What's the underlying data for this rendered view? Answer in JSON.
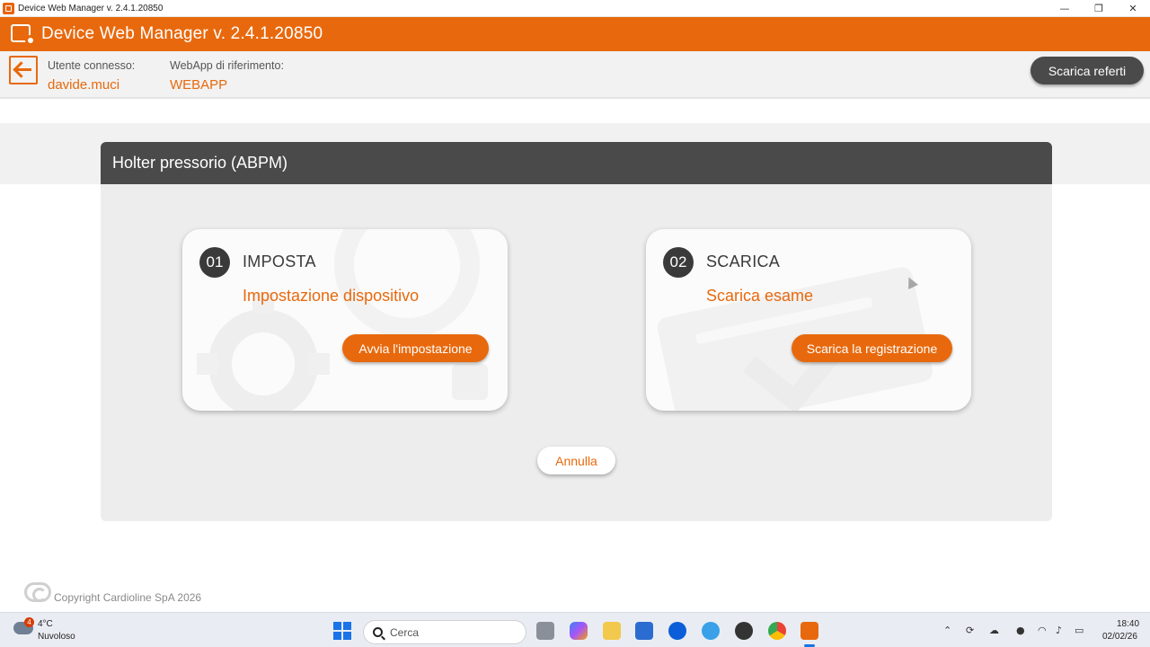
{
  "window": {
    "title": "Device Web Manager v. 2.4.1.20850",
    "controls": {
      "minimize": "—",
      "restore": "❐",
      "close": "✕"
    }
  },
  "header": {
    "app_name": "Device Web Manager v. 2.4.1.20850"
  },
  "info": {
    "user_label": "Utente connesso:",
    "user_value": "davide.muci",
    "webapp_label": "WebApp di riferimento:",
    "webapp_value": "WEBAPP",
    "download_reports_button": "Scarica referti"
  },
  "panel": {
    "title": "Holter pressorio (ABPM)",
    "cards": [
      {
        "number": "01",
        "title": "IMPOSTA",
        "subtitle": "Impostazione dispositivo",
        "button": "Avvia l'impostazione",
        "icon": "gear-icon"
      },
      {
        "number": "02",
        "title": "SCARICA",
        "subtitle": "Scarica esame",
        "button": "Scarica la registrazione",
        "icon": "download-icon"
      }
    ],
    "cancel_button": "Annulla"
  },
  "footer": {
    "copyright": "Copyright Cardioline SpA 2026"
  },
  "taskbar": {
    "weather_badge": "4",
    "temperature": "4°C",
    "weather": "Nuvoloso",
    "search_placeholder": "Cerca",
    "time": "18:40",
    "date": "02/02/26"
  },
  "colors": {
    "accent": "#e8690d",
    "dark": "#4a4a4a",
    "panel_bg": "#ededed"
  }
}
